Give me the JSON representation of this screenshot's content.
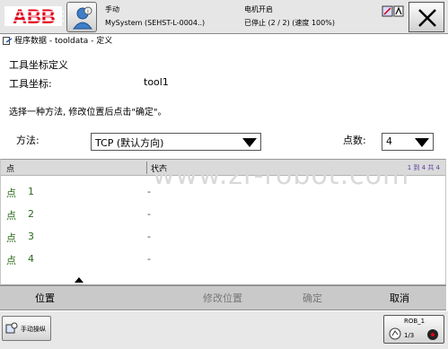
{
  "topbar": {
    "logo_text": "ABB",
    "status_line1": "手动",
    "status_line2": "MySystem (SEHST-L-0004..)",
    "status_line3": "电机开启",
    "status_line4": "已停止 (2 / 2) (速度 100%)"
  },
  "breadcrumb": "程序数据 - tooldata - 定义",
  "section_title": "工具坐标定义",
  "tool": {
    "label": "工具坐标:",
    "value": "tool1"
  },
  "instruction": "选择一种方法, 修改位置后点击\"确定\"。",
  "method": {
    "label": "方法:",
    "value": "TCP (默认方向)"
  },
  "points": {
    "label": "点数:",
    "value": "4"
  },
  "table": {
    "col_point": "点",
    "col_status": "状态",
    "range": "1 到 4 共 4",
    "rows": [
      {
        "point": "点",
        "num": "1",
        "status": "-"
      },
      {
        "point": "点",
        "num": "2",
        "status": "-"
      },
      {
        "point": "点",
        "num": "3",
        "status": "-"
      },
      {
        "point": "点",
        "num": "4",
        "status": "-"
      }
    ]
  },
  "watermark": "www.zr-robot.com",
  "commands": {
    "position": "位置",
    "modify": "修改位置",
    "ok": "确定",
    "cancel": "取消"
  },
  "taskbar": {
    "manual": "手动操纵",
    "rob": "ROB_1",
    "rob_sub": "1/3"
  },
  "colors": {
    "abb_red": "#e2001a",
    "point_green": "#2c6a1e"
  }
}
